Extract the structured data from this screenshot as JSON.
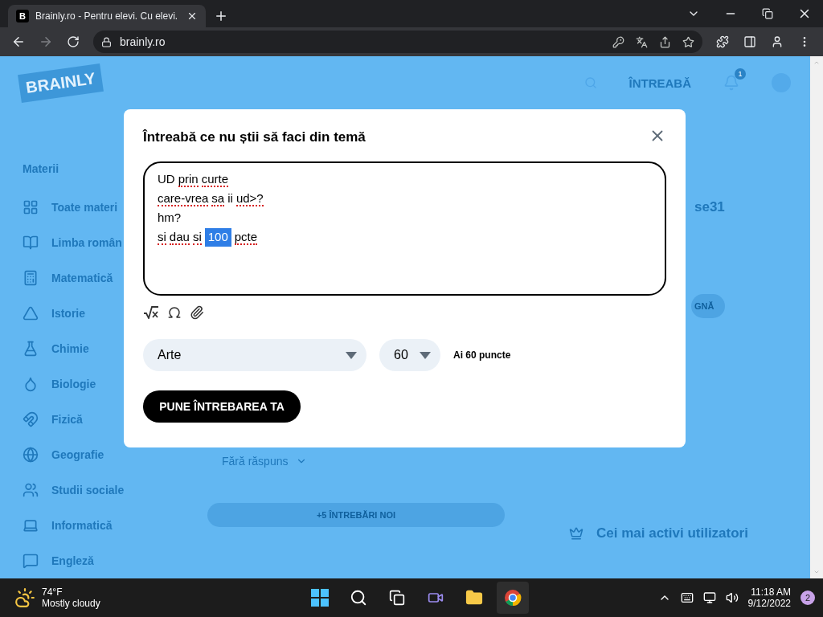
{
  "browser": {
    "tab": {
      "favicon": "B",
      "title": "Brainly.ro - Pentru elevi. Cu elevi.",
      "selected": true
    },
    "address": "brainly.ro",
    "forward_disabled": true
  },
  "page": {
    "header": {
      "logo": "BRAINLY",
      "ask": "ÎNTREABĂ",
      "notification_count": "1"
    },
    "sidebar": {
      "heading": "Materii",
      "items": [
        "Toate materi",
        "Limba român",
        "Matematică",
        "Istorie",
        "Chimie",
        "Biologie",
        "Fizică",
        "Geografie",
        "Studii sociale",
        "Informatică",
        "Engleză"
      ]
    },
    "feed": {
      "filter": "Fără răspuns",
      "new_questions": "+5 ÎNTREBĂRI NOI"
    },
    "right": {
      "username": "se31",
      "button": "GNĂ",
      "top_users": "Cei mai activi utilizatori"
    }
  },
  "dialog": {
    "title": "Întreabă ce nu știi să faci din temă",
    "lines": [
      [
        {
          "text": "UD",
          "misspelled": false,
          "selected": false
        },
        {
          "text": "prin",
          "misspelled": true,
          "selected": false
        },
        {
          "text": "curte",
          "misspelled": true,
          "selected": false
        }
      ],
      [
        {
          "text": "care-vrea",
          "misspelled": true,
          "selected": false
        },
        {
          "text": "sa",
          "misspelled": true,
          "selected": false
        },
        {
          "text": "ii",
          "misspelled": false,
          "selected": false
        },
        {
          "text": "ud>?",
          "misspelled": true,
          "selected": false
        }
      ],
      [
        {
          "text": "hm?",
          "misspelled": false,
          "selected": false
        }
      ],
      [
        {
          "text": "si",
          "misspelled": true,
          "selected": false
        },
        {
          "text": "dau",
          "misspelled": true,
          "selected": false
        },
        {
          "text": "si",
          "misspelled": true,
          "selected": false
        },
        {
          "text": "100",
          "misspelled": false,
          "selected": true
        },
        {
          "text": "pcte",
          "misspelled": true,
          "selected": false
        }
      ]
    ],
    "subject": "Arte",
    "points": "60",
    "points_note": "Ai 60 puncte",
    "submit": "PUNE ÎNTREBAREA TA"
  },
  "taskbar": {
    "temperature": "74°F",
    "weather": "Mostly cloudy",
    "time": "11:18 AM",
    "date": "9/12/2022",
    "notifications": "2"
  }
}
